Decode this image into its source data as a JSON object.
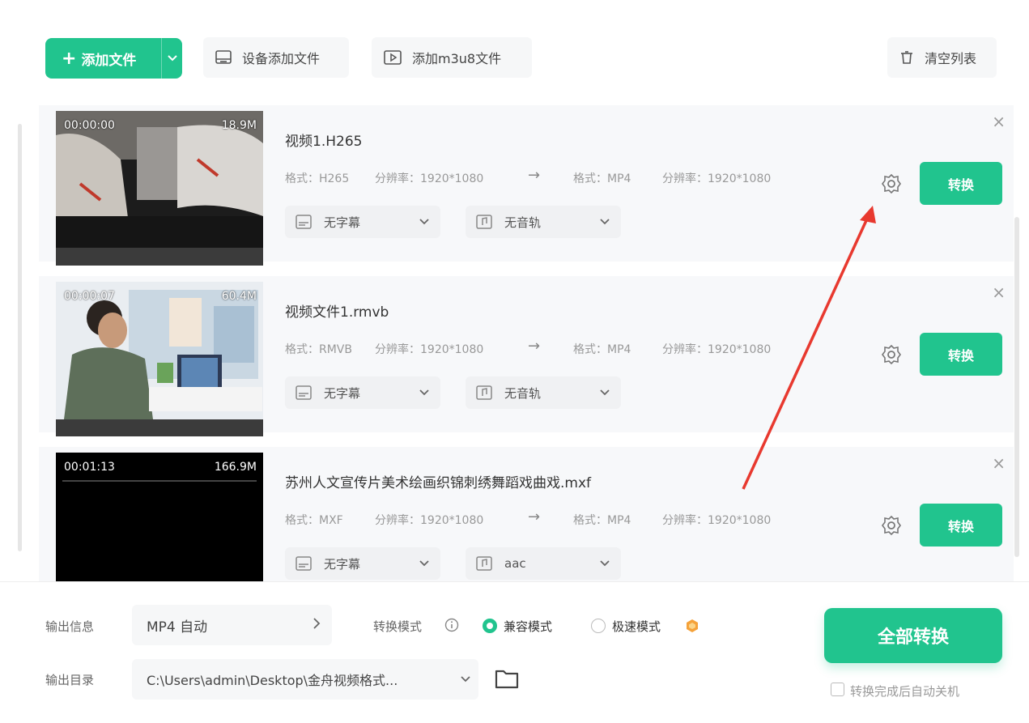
{
  "toolbar": {
    "add_file_label": "添加文件",
    "device_add_label": "设备添加文件",
    "add_m3u8_label": "添加m3u8文件",
    "clear_list_label": "清空列表"
  },
  "files": [
    {
      "duration": "00:00:00",
      "size": "18.9M",
      "name": "视频1.H265",
      "src_format": "格式：H265",
      "src_resolution": "分辨率：1920*1080",
      "dst_format": "格式：MP4",
      "dst_resolution": "分辨率：1920*1080",
      "subtitle": "无字幕",
      "audio": "无音轨",
      "convert_label": "转换"
    },
    {
      "duration": "00:00:07",
      "size": "60.4M",
      "name": "视频文件1.rmvb",
      "src_format": "格式：RMVB",
      "src_resolution": "分辨率：1920*1080",
      "dst_format": "格式：MP4",
      "dst_resolution": "分辨率：1920*1080",
      "subtitle": "无字幕",
      "audio": "无音轨",
      "convert_label": "转换"
    },
    {
      "duration": "00:01:13",
      "size": "166.9M",
      "name": "苏州人文宣传片美术绘画织锦刺绣舞蹈戏曲戏.mxf",
      "src_format": "格式：MXF",
      "src_resolution": "分辨率：1920*1080",
      "dst_format": "格式：MP4",
      "dst_resolution": "分辨率：1920*1080",
      "subtitle": "无字幕",
      "audio": "aac",
      "convert_label": "转换"
    }
  ],
  "bottom": {
    "output_info_label": "输出信息",
    "output_info_value": "MP4 自动",
    "convert_mode_label": "转换模式",
    "mode_compatible": "兼容模式",
    "mode_fast": "极速模式",
    "output_dir_label": "输出目录",
    "output_dir_value": "C:\\Users\\admin\\Desktop\\金舟视频格式...",
    "convert_all_label": "全部转换",
    "auto_shutdown_label": "转换完成后自动关机"
  },
  "colors": {
    "accent": "#21c48e",
    "annotation": "#e8392f"
  }
}
